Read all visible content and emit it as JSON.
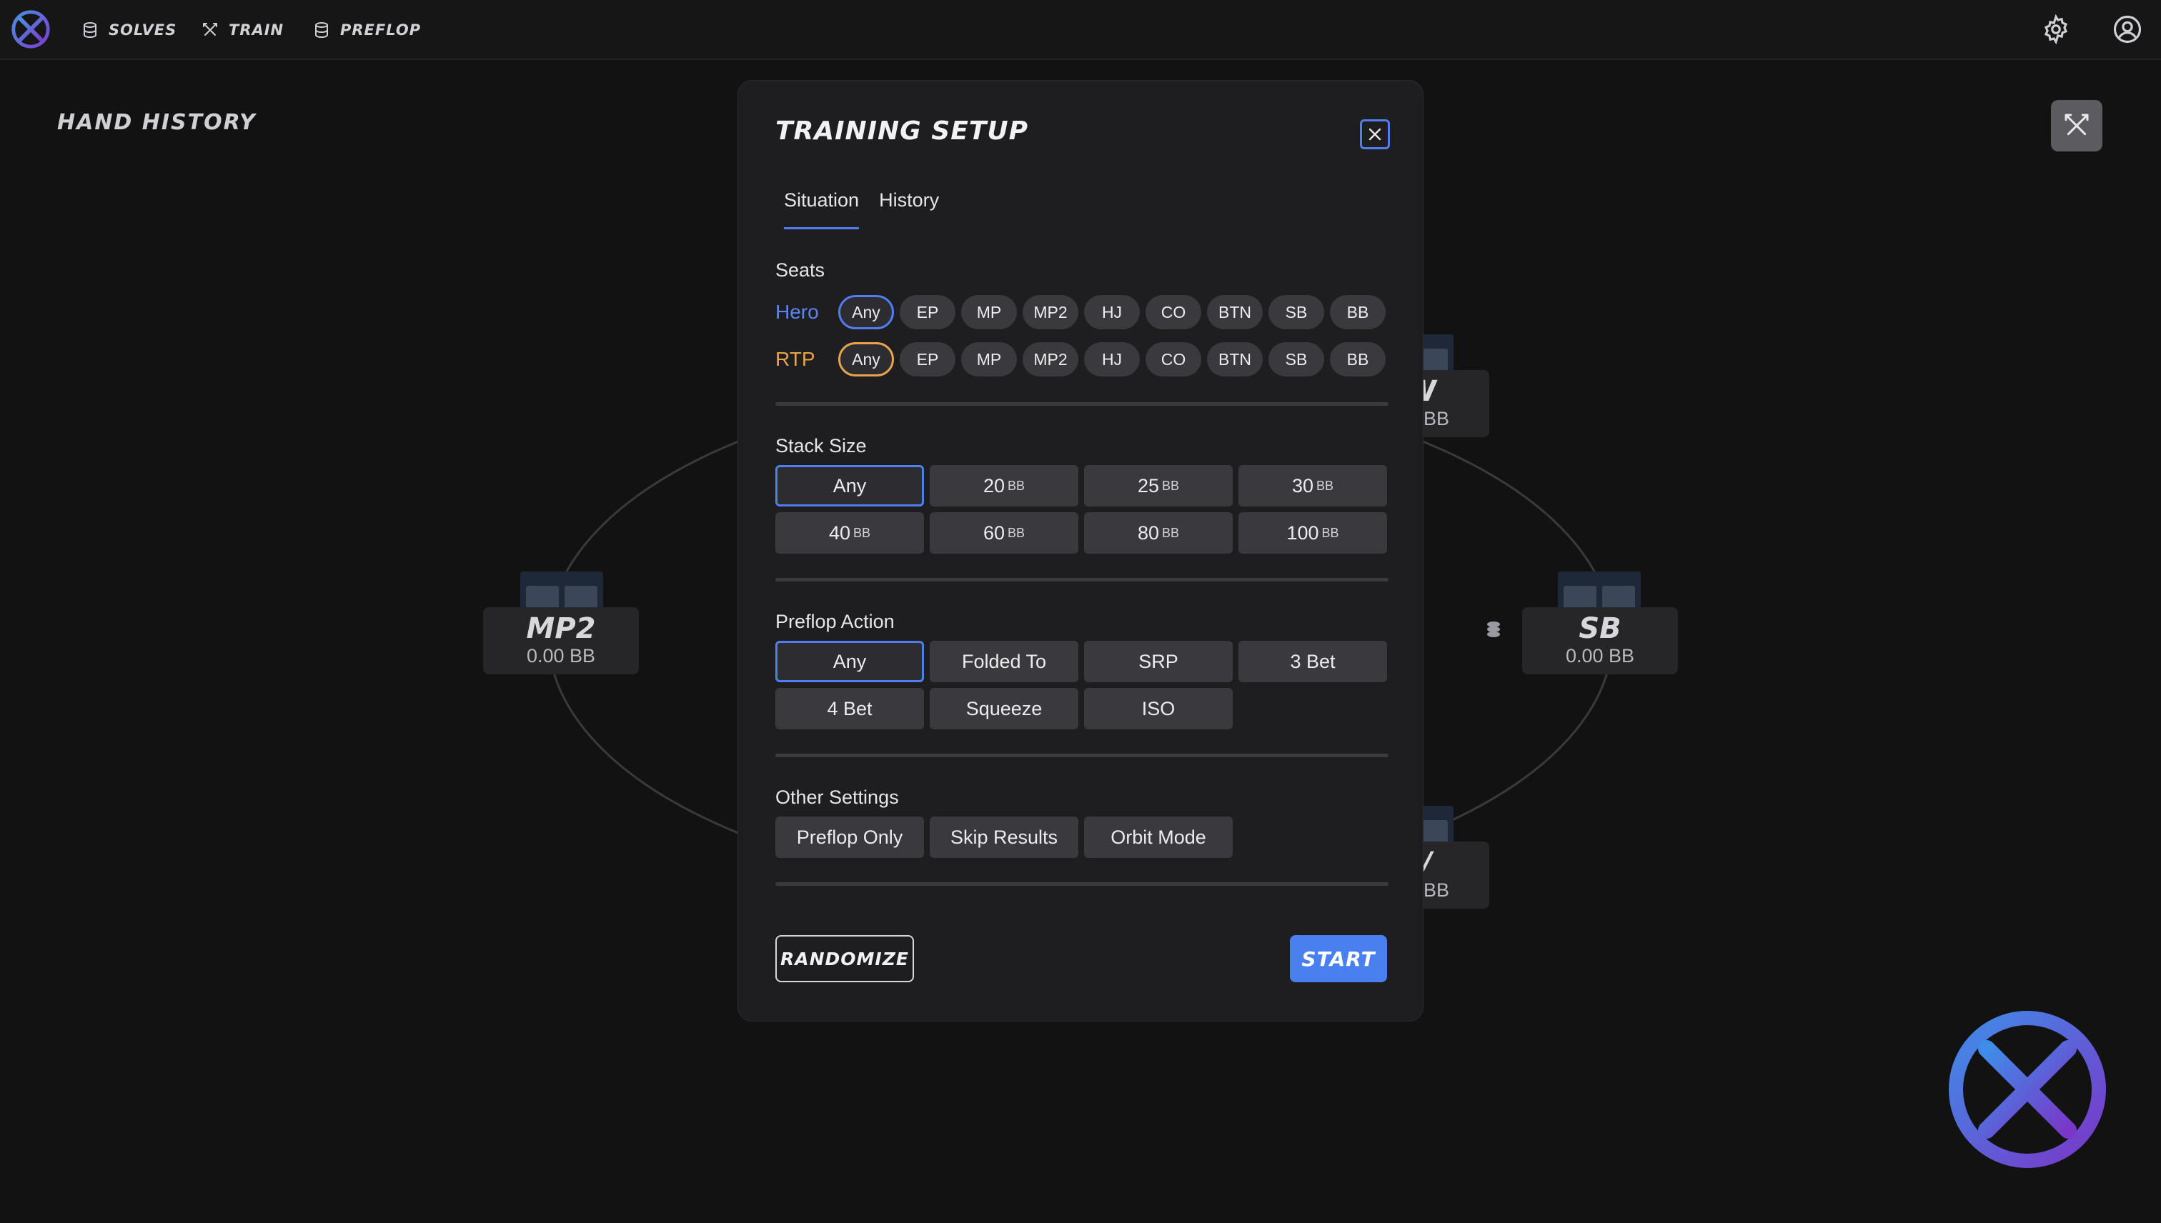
{
  "nav": {
    "items": [
      {
        "label": "SOLVES",
        "icon": "database-icon"
      },
      {
        "label": "TRAIN",
        "icon": "swords-icon"
      },
      {
        "label": "PREFLOP",
        "icon": "database-icon"
      }
    ],
    "settings_icon": "gear-icon",
    "profile_icon": "user-circle-icon"
  },
  "page": {
    "title": "HAND HISTORY"
  },
  "table": {
    "seats": [
      {
        "name": "MP2",
        "stack": "0.00 BB"
      },
      {
        "name": "SB",
        "stack": "0.00 BB"
      },
      {
        "name": "W",
        "stack": "BB"
      },
      {
        "name": "/",
        "stack": "BB"
      }
    ]
  },
  "modal": {
    "title": "TRAINING SETUP",
    "tabs": [
      {
        "label": "Situation",
        "active": true
      },
      {
        "label": "History",
        "active": false
      }
    ],
    "seats": {
      "label": "Seats",
      "hero_label": "Hero",
      "rtp_label": "RTP",
      "options": [
        "Any",
        "EP",
        "MP",
        "MP2",
        "HJ",
        "CO",
        "BTN",
        "SB",
        "BB"
      ],
      "hero_selected": "Any",
      "rtp_selected": "Any"
    },
    "stack_size": {
      "label": "Stack Size",
      "options": [
        {
          "value": "Any",
          "unit": ""
        },
        {
          "value": "20",
          "unit": "BB"
        },
        {
          "value": "25",
          "unit": "BB"
        },
        {
          "value": "30",
          "unit": "BB"
        },
        {
          "value": "40",
          "unit": "BB"
        },
        {
          "value": "60",
          "unit": "BB"
        },
        {
          "value": "80",
          "unit": "BB"
        },
        {
          "value": "100",
          "unit": "BB"
        }
      ],
      "selected": "Any"
    },
    "preflop_action": {
      "label": "Preflop Action",
      "options": [
        "Any",
        "Folded To",
        "SRP",
        "3 Bet",
        "4 Bet",
        "Squeeze",
        "ISO"
      ],
      "selected": "Any"
    },
    "other_settings": {
      "label": "Other Settings",
      "options": [
        "Preflop Only",
        "Skip Results",
        "Orbit Mode"
      ]
    },
    "randomize_label": "RANDOMIZE",
    "start_label": "START"
  },
  "colors": {
    "accent_blue": "#4f7ef0",
    "hero_blue": "#5b86f2",
    "rtp_orange": "#e8a34c",
    "background": "#121213",
    "panel": "#1e1e20"
  }
}
